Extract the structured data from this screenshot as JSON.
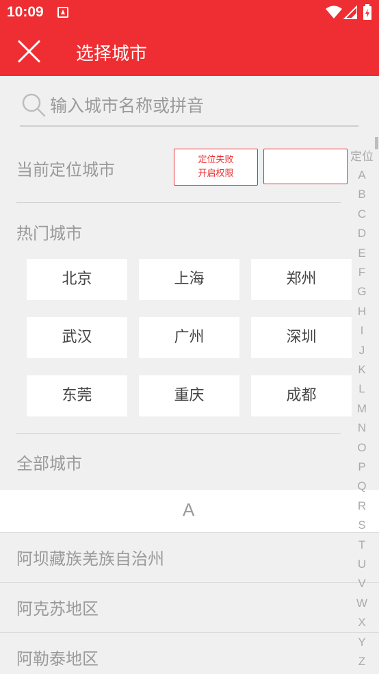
{
  "status_bar": {
    "time": "10:09"
  },
  "app_bar": {
    "title": "选择城市"
  },
  "search": {
    "placeholder": "输入城市名称或拼音"
  },
  "location": {
    "label": "当前定位城市",
    "fail_line1": "定位失败",
    "fail_line2": "开启权限",
    "empty_value": ""
  },
  "hot": {
    "label": "热门城市",
    "cities": [
      "北京",
      "上海",
      "郑州",
      "武汉",
      "广州",
      "深圳",
      "东莞",
      "重庆",
      "成都"
    ]
  },
  "all": {
    "label": "全部城市",
    "group_letter": "A",
    "cities": [
      "阿坝藏族羌族自治州",
      "阿克苏地区",
      "阿勒泰地区"
    ]
  },
  "index": [
    "定位",
    "A",
    "B",
    "C",
    "D",
    "E",
    "F",
    "G",
    "H",
    "I",
    "J",
    "K",
    "L",
    "M",
    "N",
    "O",
    "P",
    "Q",
    "R",
    "S",
    "T",
    "U",
    "V",
    "W",
    "X",
    "Y",
    "Z"
  ],
  "colors": {
    "accent": "#ee2e32"
  }
}
